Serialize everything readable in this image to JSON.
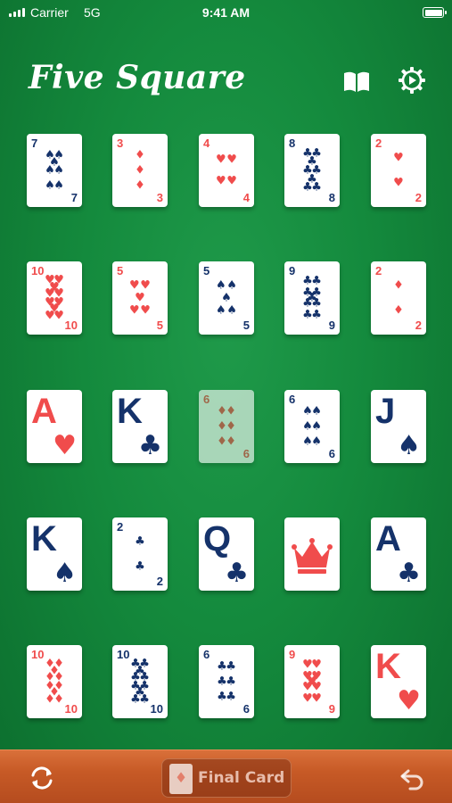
{
  "status_bar": {
    "carrier": "Carrier",
    "network": "5G",
    "time": "9:41 AM"
  },
  "header": {
    "title": "Five Square",
    "book_icon": "book-icon",
    "settings_icon": "gear-play-icon"
  },
  "colors": {
    "felt": "#148a3d",
    "red_suit": "#f04c4c",
    "black_suit": "#15326a",
    "wood": "#c75a26"
  },
  "cards": [
    [
      {
        "rank": "7",
        "suit": "♠",
        "color": "black"
      },
      {
        "rank": "3",
        "suit": "♦",
        "color": "red"
      },
      {
        "rank": "4",
        "suit": "♥",
        "color": "red"
      },
      {
        "rank": "8",
        "suit": "♣",
        "color": "black"
      },
      {
        "rank": "2",
        "suit": "♥",
        "color": "red"
      }
    ],
    [
      {
        "rank": "10",
        "suit": "♥",
        "color": "red"
      },
      {
        "rank": "5",
        "suit": "♥",
        "color": "red"
      },
      {
        "rank": "5",
        "suit": "♠",
        "color": "black"
      },
      {
        "rank": "9",
        "suit": "♣",
        "color": "black"
      },
      {
        "rank": "2",
        "suit": "♦",
        "color": "red"
      }
    ],
    [
      {
        "rank": "A",
        "suit": "♥",
        "color": "red",
        "face": true
      },
      {
        "rank": "K",
        "suit": "♣",
        "color": "black",
        "face": true
      },
      {
        "rank": "6",
        "suit": "♦",
        "color": "red",
        "faded": true
      },
      {
        "rank": "6",
        "suit": "♠",
        "color": "black"
      },
      {
        "rank": "J",
        "suit": "♠",
        "color": "black",
        "face": true
      }
    ],
    [
      {
        "rank": "K",
        "suit": "♠",
        "color": "black",
        "face": true
      },
      {
        "rank": "2",
        "suit": "♣",
        "color": "black"
      },
      {
        "rank": "Q",
        "suit": "♣",
        "color": "black",
        "face": true
      },
      {
        "rank": "",
        "suit": "crown",
        "color": "red",
        "joker": true
      },
      {
        "rank": "A",
        "suit": "♣",
        "color": "black",
        "face": true
      }
    ],
    [
      {
        "rank": "10",
        "suit": "♦",
        "color": "red"
      },
      {
        "rank": "10",
        "suit": "♣",
        "color": "black"
      },
      {
        "rank": "6",
        "suit": "♣",
        "color": "black"
      },
      {
        "rank": "9",
        "suit": "♥",
        "color": "red"
      },
      {
        "rank": "K",
        "suit": "♥",
        "color": "red",
        "face": true
      }
    ]
  ],
  "bottom_bar": {
    "refresh_icon": "refresh-icon",
    "final_card_label": "Final Card",
    "undo_icon": "undo-icon"
  }
}
